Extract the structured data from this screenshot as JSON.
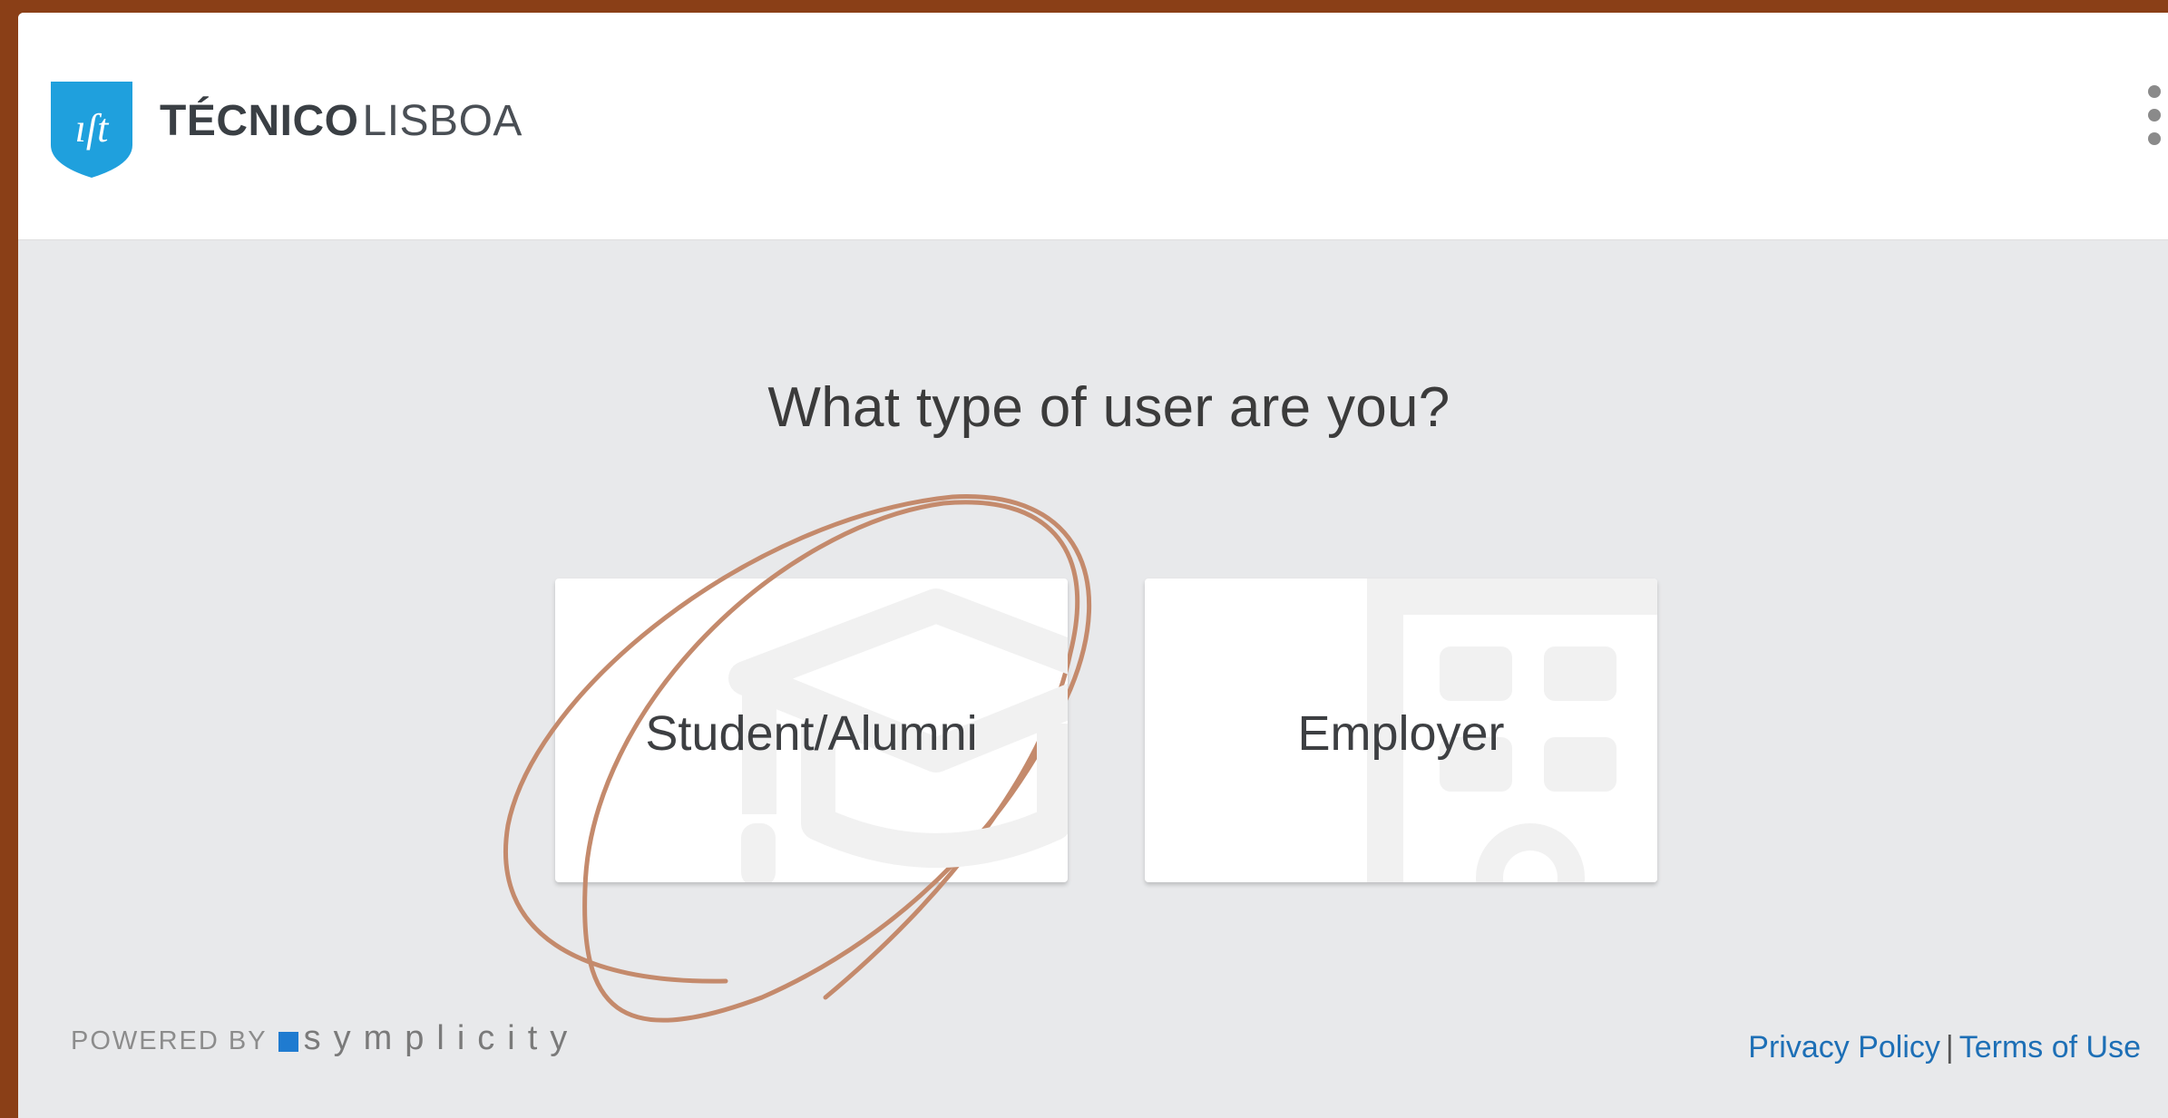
{
  "header": {
    "brand_strong": "TÉCNICO",
    "brand_light": "LISBOA",
    "logo_icon": "ist-shield-logo",
    "menu_icon": "more-vert-icon"
  },
  "main": {
    "question": "What type of user are you?",
    "options": [
      {
        "label": "Student/Alumni",
        "icon": "graduation-cap-icon"
      },
      {
        "label": "Employer",
        "icon": "building-icon"
      }
    ]
  },
  "footer": {
    "powered_by": "POWERED BY",
    "powered_brand": "symplicity",
    "privacy": "Privacy Policy",
    "separator": "|",
    "terms": "Terms of Use"
  },
  "colors": {
    "accent_blue": "#1d6fb6",
    "logo_blue": "#1fa0dd",
    "annotation": "#c48a6c",
    "frame": "#8a3f17"
  }
}
